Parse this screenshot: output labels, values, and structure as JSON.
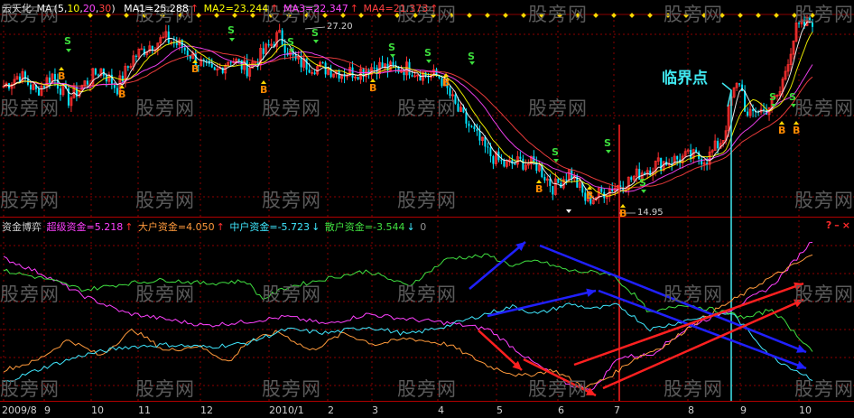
{
  "colors": {
    "ma1": "#ffffff",
    "ma2": "#ffff00",
    "ma3": "#ff44ff",
    "ma4": "#ff4040",
    "super": "#ff40ff",
    "big": "#ff9a3c",
    "mid": "#40e8ff",
    "retail": "#40e040",
    "up": "#ff3030",
    "down": "#00e5ff",
    "grid": "#8c0000",
    "sell": "#3cdc3c",
    "buy": "#ff8a00"
  },
  "price_panel": {
    "stock_name": "云天化",
    "ma_label": "MA",
    "ma_params_open": "(",
    "ma_params": [
      "5",
      "10",
      "20",
      "30"
    ],
    "ma_params_close": ")",
    "ma_values": [
      {
        "label": "MA1=25.288",
        "arrow": "↑"
      },
      {
        "label": "MA2=23.244",
        "arrow": "↑"
      },
      {
        "label": "MA3=22.347",
        "arrow": "↑"
      },
      {
        "label": "MA4=21.373",
        "arrow": "↑"
      }
    ],
    "high_label": "27.20",
    "low_label": "14.95",
    "critical_point_label": "临界点",
    "sell_marker": "S",
    "buy_marker": "B",
    "price_range": [
      13.8,
      31.0
    ]
  },
  "fund_panel": {
    "title": "资金博弈",
    "items": [
      {
        "label": "超级资金=5.218",
        "arrow": "↑"
      },
      {
        "label": "大户资金=4.050",
        "arrow": "↑"
      },
      {
        "label": "中户资金=-5.723",
        "arrow": "↓"
      },
      {
        "label": "散户资金=-3.544",
        "arrow": "↓"
      }
    ],
    "trailing_value": "0",
    "help_icon": "?",
    "minimize_icon": "–",
    "close_icon": "×"
  },
  "x_axis": {
    "labels": [
      "2009/8",
      "9",
      "10",
      "11",
      "12",
      "2010/1",
      "2",
      "3",
      "4",
      "5",
      "6",
      "7",
      "8",
      "9",
      "10"
    ]
  },
  "watermark_text": "股旁网",
  "chart_data": [
    {
      "type": "line",
      "title": "云天化",
      "x_range": [
        "2009/8",
        "2010/10"
      ],
      "y_range": [
        13.8,
        31.0
      ],
      "series": [
        {
          "name": "MA1",
          "last_value": 25.288
        },
        {
          "name": "MA2",
          "last_value": 23.244
        },
        {
          "name": "MA3",
          "last_value": 22.347
        },
        {
          "name": "MA4",
          "last_value": 21.373
        }
      ],
      "close_path": {
        "t": [
          0,
          0.02,
          0.04,
          0.06,
          0.08,
          0.1,
          0.12,
          0.14,
          0.16,
          0.18,
          0.2,
          0.22,
          0.24,
          0.26,
          0.28,
          0.3,
          0.32,
          0.34,
          0.36,
          0.38,
          0.4,
          0.42,
          0.44,
          0.46,
          0.48,
          0.5,
          0.52,
          0.54,
          0.56,
          0.58,
          0.6,
          0.62,
          0.64,
          0.66,
          0.68,
          0.7,
          0.72,
          0.73,
          0.75,
          0.77,
          0.79,
          0.81,
          0.83,
          0.85,
          0.87,
          0.89,
          0.9,
          0.91,
          0.92,
          0.93,
          0.94,
          0.95,
          0.96,
          0.97,
          0.98,
          1.0
        ],
        "close": [
          25.0,
          26.0,
          24.5,
          26.0,
          23.8,
          25.2,
          26.5,
          24.8,
          27.5,
          28.6,
          29.2,
          28.5,
          27.2,
          26.0,
          27.5,
          26.5,
          27.8,
          29.5,
          27.2,
          26.8,
          26.5,
          26.2,
          26.3,
          26.8,
          26.5,
          26.6,
          26.0,
          25.8,
          23.0,
          21.0,
          19.0,
          18.0,
          18.3,
          18.0,
          16.0,
          17.5,
          14.9,
          15.2,
          16.0,
          16.5,
          17.5,
          18.2,
          18.5,
          18.8,
          18.6,
          20.5,
          24.0,
          25.5,
          22.0,
          23.0,
          22.8,
          23.5,
          24.5,
          27.5,
          30.0,
          30.8
        ]
      },
      "high": {
        "value": 27.2,
        "date": "2010/1"
      },
      "low": {
        "value": 14.95,
        "date": "2010/7"
      },
      "sell_signals": [
        "2009/9",
        "2009/12",
        "2010/1",
        "2010/1",
        "2010/3",
        "2010/4",
        "2010/4",
        "2010/6",
        "2010/6",
        "2010/8",
        "2010/10"
      ],
      "buy_signals": [
        "2009/9",
        "2009/11",
        "2009/12",
        "2010/3",
        "2010/4",
        "2010/6",
        "2010/7",
        "2010/7",
        "2010/10",
        "2010/10"
      ]
    },
    {
      "type": "line",
      "title": "资金博弈",
      "x_range": [
        "2009/8",
        "2010/10"
      ],
      "series": [
        {
          "name": "超级资金",
          "last_value": 5.218,
          "t": [
            0,
            0.05,
            0.1,
            0.15,
            0.2,
            0.25,
            0.3,
            0.35,
            0.4,
            0.45,
            0.5,
            0.55,
            0.6,
            0.65,
            0.7,
            0.73,
            0.76,
            0.8,
            0.85,
            0.9,
            0.95,
            1.0
          ],
          "v": [
            3.8,
            2.5,
            0.8,
            -0.5,
            -1.0,
            -1.5,
            -1.2,
            -0.8,
            -1.4,
            -0.6,
            -1.0,
            -1.3,
            -1.8,
            -4.2,
            -6.2,
            -6.5,
            -4.0,
            -3.8,
            -1.5,
            -0.2,
            1.6,
            5.2
          ]
        },
        {
          "name": "大户资金",
          "last_value": 4.05,
          "t": [
            0,
            0.04,
            0.08,
            0.12,
            0.16,
            0.2,
            0.24,
            0.28,
            0.3,
            0.34,
            0.38,
            0.42,
            0.46,
            0.5,
            0.55,
            0.6,
            0.64,
            0.68,
            0.72,
            0.75,
            0.78,
            0.82,
            0.85,
            0.88,
            0.91,
            0.94,
            0.97,
            1.0
          ],
          "v": [
            -5.0,
            -4.3,
            -2.6,
            -3.9,
            -1.8,
            -3.5,
            -3.1,
            -4.4,
            -2.8,
            -2.0,
            -3.5,
            -2.1,
            -3.0,
            -2.5,
            -3.0,
            -4.7,
            -5.5,
            -5.0,
            -6.4,
            -5.5,
            -4.1,
            -3.0,
            -1.5,
            -0.3,
            0.8,
            2.0,
            3.0,
            4.05
          ]
        },
        {
          "name": "中户资金",
          "last_value": -5.723,
          "t": [
            0,
            0.05,
            0.1,
            0.15,
            0.2,
            0.25,
            0.3,
            0.35,
            0.4,
            0.45,
            0.5,
            0.55,
            0.6,
            0.63,
            0.66,
            0.7,
            0.73,
            0.76,
            0.8,
            0.85,
            0.9,
            0.95,
            1.0
          ],
          "v": [
            -6.0,
            -4.8,
            -3.8,
            -3.2,
            -3.0,
            -3.2,
            -2.9,
            -1.8,
            -2.1,
            -1.6,
            -2.2,
            -1.5,
            -0.5,
            0.0,
            -0.6,
            0.2,
            -0.2,
            0.1,
            -1.8,
            -1.0,
            -0.5,
            -4.0,
            -5.7
          ]
        },
        {
          "name": "散户资金",
          "last_value": -3.544,
          "t": [
            0,
            0.05,
            0.1,
            0.15,
            0.2,
            0.25,
            0.3,
            0.32,
            0.35,
            0.4,
            0.45,
            0.5,
            0.55,
            0.6,
            0.63,
            0.66,
            0.7,
            0.75,
            0.78,
            0.8,
            0.84,
            0.88,
            0.92,
            0.95,
            1.0
          ],
          "v": [
            2.8,
            2.2,
            1.3,
            1.8,
            2.1,
            1.8,
            2.0,
            0.6,
            1.5,
            2.2,
            2.8,
            1.6,
            3.8,
            4.0,
            3.2,
            3.6,
            2.8,
            2.6,
            0.9,
            -0.6,
            0.2,
            -0.3,
            -0.9,
            -0.2,
            -3.5
          ]
        }
      ]
    }
  ]
}
